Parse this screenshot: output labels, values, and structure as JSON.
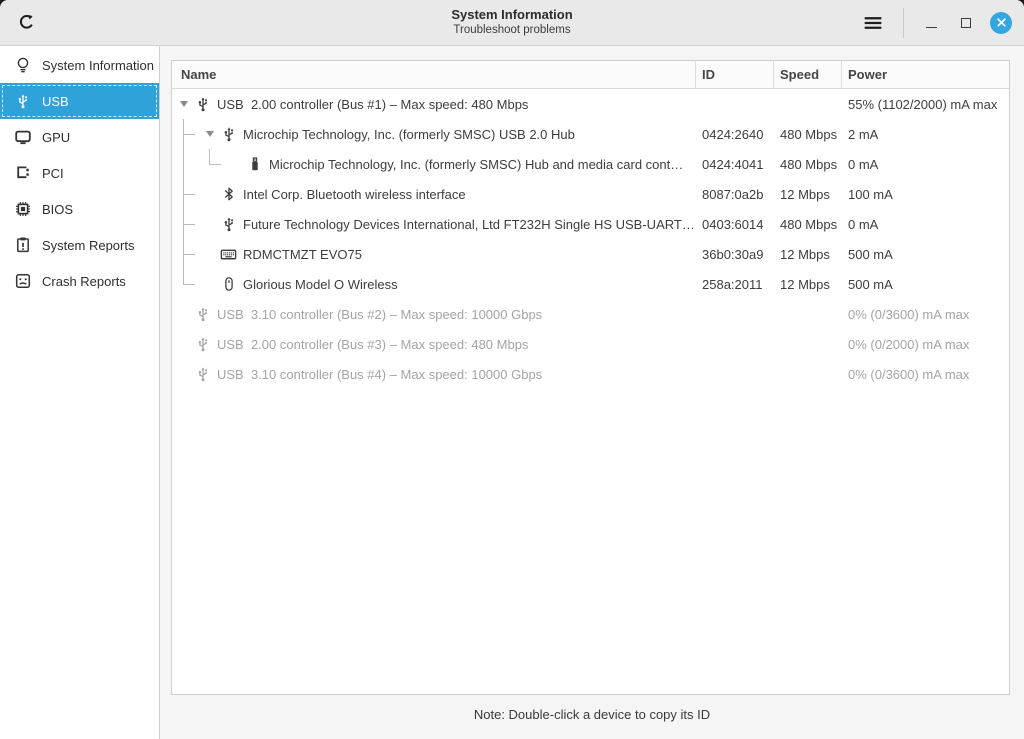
{
  "colors": {
    "accent": "#2fa2da",
    "close_button": "#33a7e0"
  },
  "window": {
    "title": "System Information",
    "subtitle": "Troubleshoot problems",
    "titlebar_icons": [
      "refresh-icon",
      "menu-icon",
      "minimize-icon",
      "maximize-icon",
      "close-icon"
    ]
  },
  "sidebar": {
    "items": [
      {
        "label": "System Information",
        "icon": "lightbulb",
        "selected": false
      },
      {
        "label": "USB",
        "icon": "usb",
        "selected": true
      },
      {
        "label": "GPU",
        "icon": "monitor",
        "selected": false
      },
      {
        "label": "PCI",
        "icon": "pci",
        "selected": false
      },
      {
        "label": "BIOS",
        "icon": "chip",
        "selected": false
      },
      {
        "label": "System Reports",
        "icon": "clipboard",
        "selected": false
      },
      {
        "label": "Crash Reports",
        "icon": "sad-face",
        "selected": false
      }
    ]
  },
  "table": {
    "columns": [
      {
        "label": "Name"
      },
      {
        "label": "ID"
      },
      {
        "label": "Speed"
      },
      {
        "label": "Power"
      }
    ],
    "rows": [
      {
        "name": "USB  2.00 controller (Bus #1) – Max speed: 480 Mbps",
        "id": "",
        "speed": "",
        "power": "55% (1102/2000) mA max",
        "icon": "usb",
        "expander": true,
        "slots": [],
        "dimmed": false
      },
      {
        "name": "Microchip Technology, Inc. (formerly SMSC) USB 2.0 Hub",
        "id": "0424:2640",
        "speed": "480 Mbps",
        "power": "2 mA",
        "icon": "usb",
        "expander": true,
        "slots": [
          "branch"
        ],
        "dimmed": false
      },
      {
        "name": "Microchip Technology, Inc. (formerly SMSC) Hub and media card cont…",
        "id": "0424:4041",
        "speed": "480 Mbps",
        "power": "0 mA",
        "icon": "flash-drive",
        "expander": false,
        "slots": [
          "line",
          "end"
        ],
        "dimmed": false
      },
      {
        "name": "Intel Corp. Bluetooth wireless interface",
        "id": "8087:0a2b",
        "speed": "12 Mbps",
        "power": "100 mA",
        "icon": "bluetooth",
        "expander": false,
        "slots": [
          "branch"
        ],
        "dimmed": false
      },
      {
        "name": "Future Technology Devices International, Ltd FT232H Single HS USB-UART…",
        "id": "0403:6014",
        "speed": "480 Mbps",
        "power": "0 mA",
        "icon": "usb",
        "expander": false,
        "slots": [
          "branch"
        ],
        "dimmed": false
      },
      {
        "name": "RDMCTMZT EVO75",
        "id": "36b0:30a9",
        "speed": "12 Mbps",
        "power": "500 mA",
        "icon": "keyboard",
        "expander": false,
        "slots": [
          "branch"
        ],
        "dimmed": false
      },
      {
        "name": "Glorious Model O Wireless",
        "id": "258a:2011",
        "speed": "12 Mbps",
        "power": "500 mA",
        "icon": "mouse",
        "expander": false,
        "slots": [
          "end"
        ],
        "dimmed": false
      },
      {
        "name": "USB  3.10 controller (Bus #2) – Max speed: 10000 Gbps",
        "id": "",
        "speed": "",
        "power": "0% (0/3600) mA max",
        "icon": "usb",
        "expander": false,
        "slots": [],
        "dimmed": true
      },
      {
        "name": "USB  2.00 controller (Bus #3) – Max speed: 480 Mbps",
        "id": "",
        "speed": "",
        "power": "0% (0/2000) mA max",
        "icon": "usb",
        "expander": false,
        "slots": [],
        "dimmed": true
      },
      {
        "name": "USB  3.10 controller (Bus #4) – Max speed: 10000 Gbps",
        "id": "",
        "speed": "",
        "power": "0% (0/3600) mA max",
        "icon": "usb",
        "expander": false,
        "slots": [],
        "dimmed": true
      }
    ]
  },
  "footer": {
    "note": "Note: Double-click a device to copy its ID"
  }
}
